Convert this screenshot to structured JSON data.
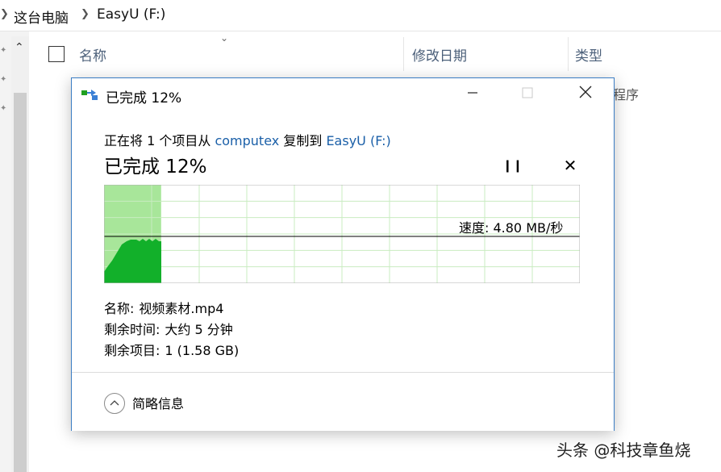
{
  "explorer": {
    "breadcrumb": [
      "这台电脑",
      "EasyU (F:)"
    ],
    "columns": {
      "name": "名称",
      "modified": "修改日期",
      "type": "类型"
    },
    "row_type_partial": "程序"
  },
  "dialog": {
    "title": "已完成 12%",
    "status": {
      "prefix": "正在将 1 个项目从",
      "source": "computex",
      "middle": "复制到",
      "destination": "EasyU (F:)"
    },
    "percent_label": "已完成 12%",
    "progress_fraction": 0.12,
    "speed": "速度: 4.80 MB/秒",
    "name_label": "名称:",
    "name_value": "视频素材.mp4",
    "time_label": "剩余时间:",
    "time_value": "大约 5 分钟",
    "items_label": "剩余项目:",
    "items_value": "1 (1.58 GB)",
    "more_info": "简略信息"
  },
  "watermark": "头条 @科技章鱼烧",
  "colors": {
    "accent_border": "#3b7dc4",
    "link": "#1a5fa8",
    "progress_fill": "#a8e69a",
    "speed_fill": "#12b02a",
    "grid": "#c9ecc1"
  }
}
